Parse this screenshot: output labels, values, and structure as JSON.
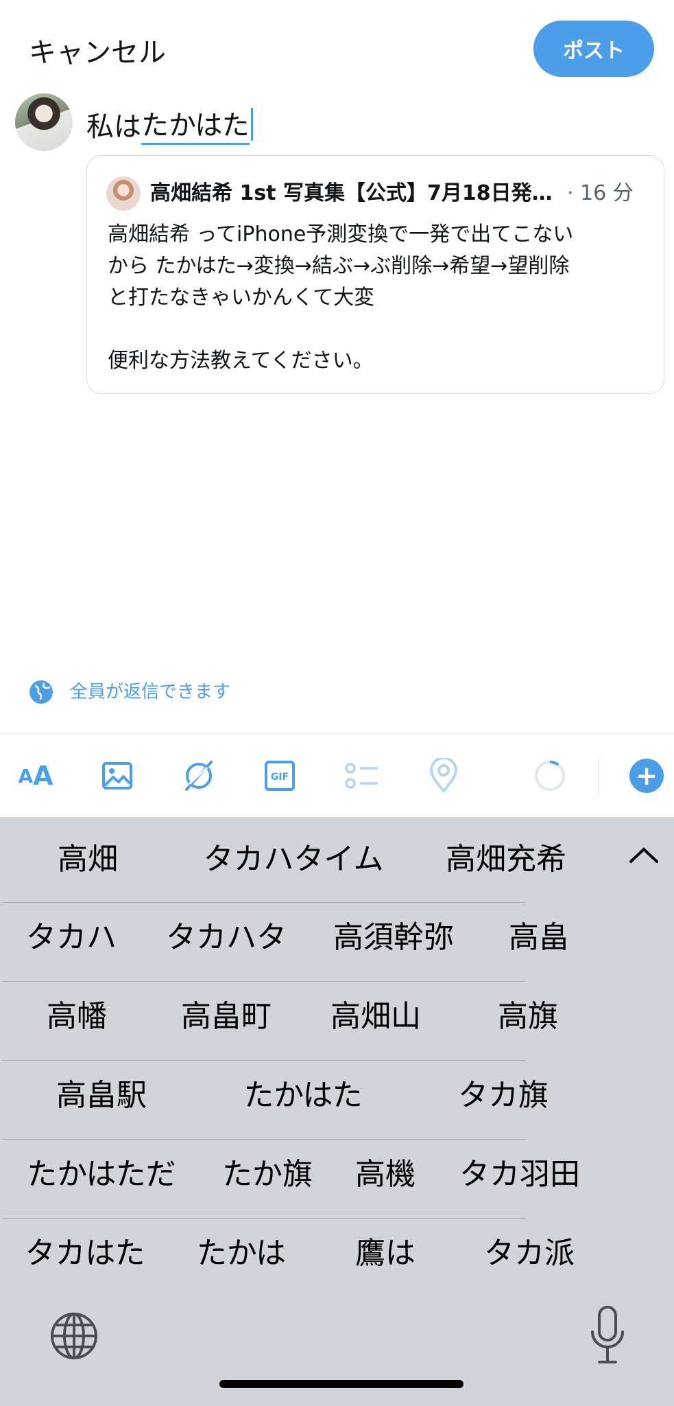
{
  "header": {
    "cancel_label": "キャンセル",
    "post_label": "ポスト"
  },
  "compose": {
    "prefix": "私は",
    "composing": "たかはた"
  },
  "quote": {
    "author": "高畑結希 1st 写真集【公式】7月18日発…",
    "time": "· 16 分",
    "body_lines": [
      "高畑結希 ってiPhone予測変換で一発で出てこない",
      "から たかはた→変換→結ぶ→ぶ削除→希望→望削除",
      "と打たなきゃいかんくて大変",
      "便利な方法教えてください。"
    ]
  },
  "reply_setting": "全員が返信できます",
  "toolbar": {
    "text_format_small": "A",
    "text_format_big": "A",
    "icons": [
      "text-format-icon",
      "image-icon",
      "grok-icon",
      "gif-icon",
      "poll-icon",
      "location-icon",
      "character-counter",
      "add-icon"
    ],
    "accent_color": "#4c9ee8"
  },
  "keyboard": {
    "background": "#d1d5db",
    "rows": [
      [
        "高畑",
        "タカハタイム",
        "高畑充希"
      ],
      [
        "タカハ",
        "タカハタ",
        "高須幹弥",
        "高畠"
      ],
      [
        "高幡",
        "高畠町",
        "高畑山",
        "高旗"
      ],
      [
        "高畠駅",
        "たかはた",
        "タカ旗"
      ],
      [
        "たかはただ",
        "たか旗",
        "高機",
        "タカ羽田"
      ],
      [
        "タカはた",
        "たかは",
        "鷹は",
        "タカ派"
      ]
    ]
  }
}
